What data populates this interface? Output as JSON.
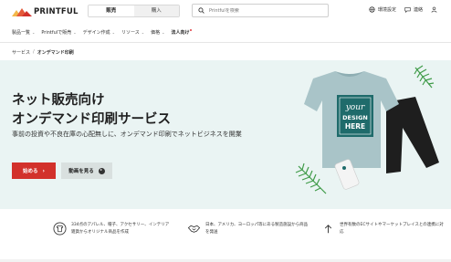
{
  "brand": {
    "name": "PRINTFUL",
    "accent": "#d2312b",
    "hero_bg": "#eaf4f3"
  },
  "header": {
    "segments": [
      {
        "label": "販売",
        "active": true
      },
      {
        "label": "購入",
        "active": false
      }
    ],
    "search": {
      "placeholder": "Printfulを検索",
      "icon": "search-icon"
    },
    "links": [
      {
        "label": "環境設定",
        "icon": "globe-icon"
      },
      {
        "label": "連絡",
        "icon": "chat-icon"
      }
    ]
  },
  "nav": {
    "items": [
      {
        "label": "製品一覧",
        "dropdown": true
      },
      {
        "label": "Printfulで販売",
        "dropdown": true
      },
      {
        "label": "デザイン作成",
        "dropdown": true
      },
      {
        "label": "リソース",
        "dropdown": true
      },
      {
        "label": "価格",
        "dropdown": true
      },
      {
        "label": "法人向け",
        "dropdown": false,
        "badge": "new-dot"
      }
    ]
  },
  "breadcrumb": {
    "items": [
      "サービス",
      "オンデマンド印刷"
    ],
    "separator": "/"
  },
  "hero": {
    "title_line1": "ネット販売向け",
    "title_line2": "オンデマンド印刷サービス",
    "subtitle": "事前の投資や不良在庫の心配無しに、オンデマンド印刷でネットビジネスを開業",
    "primary_button": "始める",
    "secondary_button": "動画を見る",
    "tshirt_text": "your DESIGN HERE"
  },
  "features": [
    {
      "icon": "tshirt-icon",
      "text": "334点のアパレル、帽子、アクセサリー、インテリア雑貨からオリジナル商品を作成"
    },
    {
      "icon": "handshake-icon",
      "text": "日本、アメリカ、ヨーロッパ等にある製造施設から商品を発送"
    },
    {
      "icon": "upload-icon",
      "text": "世界有数のECサイトやマーケットプレイスとの連携に対応"
    }
  ]
}
